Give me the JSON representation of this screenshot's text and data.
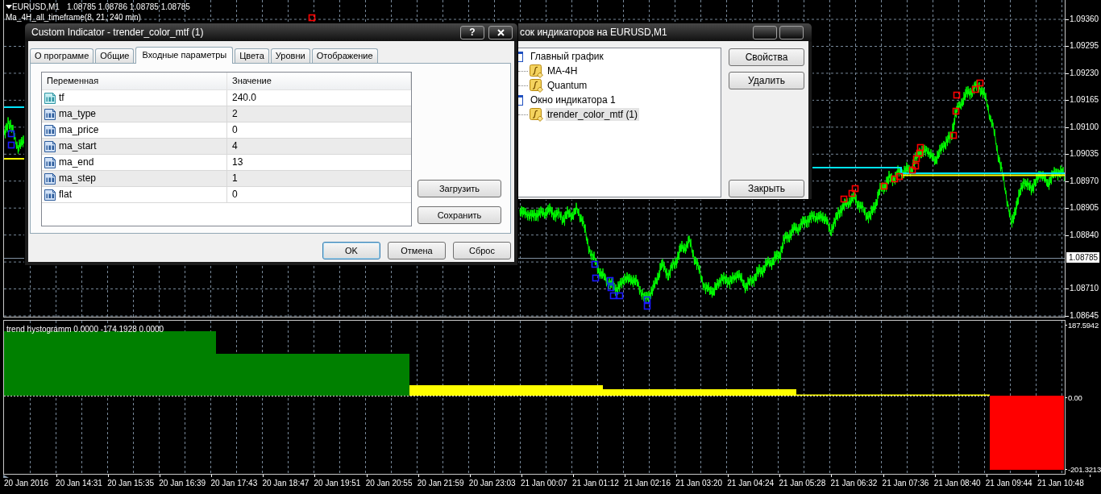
{
  "chart": {
    "symbol": "EURUSD,M1",
    "quotes": "1.08785 1.08786 1.08785 1.08785",
    "indicator_label": "Ma_4H_all_timeframe(8, 21, 240 min)"
  },
  "properties_dialog": {
    "title": "Custom Indicator - trender_color_mtf (1)",
    "help_button": "?",
    "tabs": [
      {
        "label": "О программе",
        "selected": false
      },
      {
        "label": "Общие",
        "selected": false
      },
      {
        "label": "Входные параметры",
        "selected": true
      },
      {
        "label": "Цвета",
        "selected": false
      },
      {
        "label": "Уровни",
        "selected": false
      },
      {
        "label": "Отображение",
        "selected": false
      }
    ],
    "table": {
      "columns": [
        "Переменная",
        "Значение"
      ],
      "rows": [
        {
          "kind": "double",
          "name": "tf",
          "value": "240.0"
        },
        {
          "kind": "int",
          "name": "ma_type",
          "value": "2"
        },
        {
          "kind": "int",
          "name": "ma_price",
          "value": "0"
        },
        {
          "kind": "int",
          "name": "ma_start",
          "value": "4"
        },
        {
          "kind": "int",
          "name": "ma_end",
          "value": "13"
        },
        {
          "kind": "int",
          "name": "ma_step",
          "value": "1"
        },
        {
          "kind": "int",
          "name": "flat",
          "value": "0"
        }
      ]
    },
    "side_buttons": [
      "Загрузить",
      "Сохранить"
    ],
    "buttons": [
      {
        "label": "OK",
        "default": true
      },
      {
        "label": "Отмена",
        "default": false
      },
      {
        "label": "Сброс",
        "default": false
      }
    ]
  },
  "indicators_dialog": {
    "title": "сок индикаторов на EURUSD,M1",
    "tree": [
      {
        "kind": "window",
        "label": "Главный график",
        "selected": false,
        "children": [
          {
            "kind": "indicator",
            "label": "MA-4H",
            "selected": false
          },
          {
            "kind": "indicator",
            "label": "Quantum",
            "selected": false
          }
        ]
      },
      {
        "kind": "window",
        "label": "Окно индикатора 1",
        "selected": false,
        "children": [
          {
            "kind": "indicator",
            "label": "trender_color_mtf (1)",
            "selected": true
          }
        ]
      }
    ],
    "buttons": [
      "Свойства",
      "Удалить",
      "Закрыть"
    ]
  },
  "price_axis": {
    "labels": [
      "1.09360",
      "1.09295",
      "1.09230",
      "1.09165",
      "1.09100",
      "1.09035",
      "1.08970",
      "1.08905",
      "1.08840",
      "1.08710",
      "1.08645"
    ],
    "current_price": "1.08785"
  },
  "indicator_window": {
    "label": "trend hystogramm 0.0000 -174.1928 0.0000",
    "axis_labels": [
      "187.5942",
      "0.00",
      "-201.3213"
    ]
  },
  "time_axis": [
    "20 Jan 2016",
    "20 Jan 14:31",
    "20 Jan 15:35",
    "20 Jan 16:39",
    "20 Jan 17:43",
    "20 Jan 18:47",
    "20 Jan 19:51",
    "20 Jan 20:55",
    "20 Jan 21:59",
    "20 Jan 23:03",
    "21 Jan 00:07",
    "21 Jan 01:12",
    "21 Jan 02:16",
    "21 Jan 03:20",
    "21 Jan 04:24",
    "21 Jan 05:28",
    "21 Jan 06:32",
    "21 Jan 07:36",
    "21 Jan 08:40",
    "21 Jan 09:44",
    "21 Jan 10:48"
  ]
}
